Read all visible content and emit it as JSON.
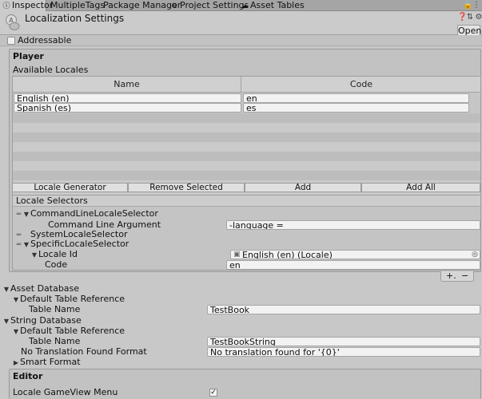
{
  "tabs": [
    {
      "label": "Inspector",
      "icon": "info-icon"
    },
    {
      "label": "MultipleTags"
    },
    {
      "label": "Package Manager"
    },
    {
      "label": "Project Settings",
      "icon": "gear-icon"
    },
    {
      "label": "Asset Tables",
      "icon": "cloud-icon"
    }
  ],
  "header": {
    "title": "Localization Settings",
    "open_label": "Open"
  },
  "addressable": {
    "label": "Addressable",
    "checked": false
  },
  "player": {
    "title": "Player",
    "available_locales_label": "Available Locales",
    "columns": [
      "Name",
      "Code"
    ],
    "rows": [
      {
        "name": "English (en)",
        "code": "en"
      },
      {
        "name": "Spanish (es)",
        "code": "es"
      }
    ],
    "buttons": [
      "Locale Generator",
      "Remove Selected",
      "Add",
      "Add All"
    ]
  },
  "locale_selectors": {
    "title": "Locale Selectors",
    "command_line_selector": "CommandLineLocaleSelector",
    "command_line_argument_label": "Command Line Argument",
    "command_line_argument_value": "-language =",
    "system_selector": "SystemLocaleSelector",
    "specific_selector": "SpecificLocaleSelector",
    "locale_id_label": "Locale Id",
    "locale_id_value": "English (en) (Locale)",
    "code_label": "Code",
    "code_value": "en",
    "add_symbol": "+.",
    "remove_symbol": "−"
  },
  "asset_database": {
    "title": "Asset Database",
    "default_table_reference": "Default Table Reference",
    "table_name_label": "Table Name",
    "table_name_value": "TestBook"
  },
  "string_database": {
    "title": "String Database",
    "default_table_reference": "Default Table Reference",
    "table_name_label": "Table Name",
    "table_name_value": "TestBookString",
    "no_translation_label": "No Translation Found Format",
    "no_translation_value": "No translation found for '{0}'",
    "smart_format_label": "Smart Format"
  },
  "editor": {
    "title": "Editor",
    "gameview_menu_label": "Locale GameView Menu",
    "gameview_menu_checked": true
  }
}
